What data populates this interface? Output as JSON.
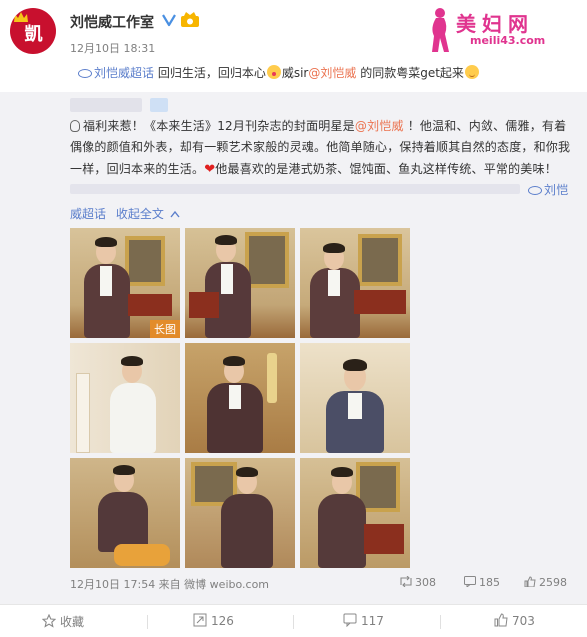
{
  "author": {
    "name": "刘恺威工作室",
    "time": "12月10日 18:31"
  },
  "watermark": {
    "title": "美妇网",
    "url": "meili43.com"
  },
  "post": {
    "topic": "刘恺威超话",
    "text1": " 回归生活，回归本心",
    "text2": "威sir",
    "mention": "@刘恺威",
    "text3": " 的同款粤菜get起来"
  },
  "repost": {
    "line1_a": "福利来惹！《本来生活》12月刊杂志的封面明星是",
    "line1_mention": "@刘恺威",
    "line1_b": " ！他温和、内敛、儒雅，有着",
    "line2": "偶像的颜值和外表，却有一颗艺术家般的灵魂。他简单随心，保持着顺其自然的态度，和你我",
    "line3_a": "一样，回归本来的生活。",
    "line3_heart": "❤",
    "line3_b": "他最喜欢的是港式奶茶、馄饨面、鱼丸这样传统、平常的美味！",
    "topic_tail": "刘恺",
    "topic_cont": "威超话",
    "collapse": "收起全文",
    "long_image": "长图",
    "footer_time": "12月10日 17:54 来自 微博 weibo.com",
    "stats": {
      "reposts": "308",
      "comments": "185",
      "likes": "2598"
    }
  },
  "actions": {
    "favorite": "收藏",
    "repost": "126",
    "comment": "117",
    "like": "703"
  },
  "colors": {
    "link": "#eb7350",
    "topic": "#5b7ecb",
    "watermark": "#e0348f",
    "avatar": "#c8102e"
  }
}
